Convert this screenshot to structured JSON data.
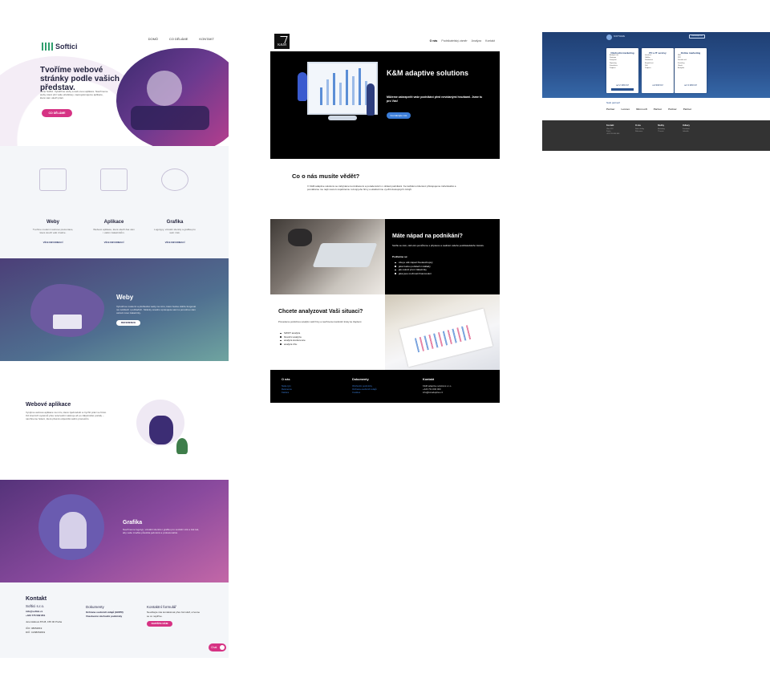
{
  "softici": {
    "logo_text": "Softici",
    "nav": [
      "DOMŮ",
      "CO DĚLÁME",
      "KONTAKT"
    ],
    "hero_title": "Tvoříme webové stránky podle vašich představ.",
    "hero_lead": "Jsme Softici. Vytváříme weby a web-ovou aplikace. Navrhneme weby, které plní vaše představy, naprogramujeme aplikace, které vám ušetří práci.",
    "hero_cta": "CO DĚLÁME",
    "services": [
      {
        "title": "Weby",
        "desc": "Tvoříme moderní webové prezentace, které slouží vaší značce.",
        "link": "VÍCE INFORMACÍ"
      },
      {
        "title": "Aplikace",
        "desc": "Webové aplikace, které ušetří čas vám i vašim zákazníkům.",
        "link": "VÍCE INFORMACÍ"
      },
      {
        "title": "Grafika",
        "desc": "Logotypy, vizuální identity a grafika pro web i tisk.",
        "link": "VÍCE INFORMACÍ"
      }
    ],
    "weby": {
      "title": "Weby",
      "desc": "Vytvoříme moderní a přehledné weby na míru, které budou dobře fungovat na mobilech i počítačích. Stránky snadno spravujete sami a pomohou vám oslovit nové zákazníky.",
      "button": "REFERENCE"
    },
    "apps": {
      "title": "Webové aplikace",
      "desc": "Vyvíjíme webové aplikace na míru, které zjednoduší a zrychlí práci ve firmě. Od interních systémů přes rezervační nástroje až po zákaznické portály – navrhneme řešení, které přesně odpovídá vašim procesům."
    },
    "graf": {
      "title": "Grafika",
      "desc": "Navrhneme logotyp, vizuální identitu i grafiku pro sociální sítě a tisk tak, aby vaše značka působila jednotně a profesionálně."
    },
    "footer": {
      "heading": "Kontakt",
      "company": "Softici s.r.o.",
      "email": "info@softici.cz",
      "phone": "+420 775 582 851",
      "address": "Jeremiášova 871/8, 155 00 Praha",
      "ico": "IČO: 08054819",
      "dic": "DIČ: CZ08054819",
      "docs_heading": "Dokumenty",
      "doc1": "Ochrana osobních údajů (GDPR)",
      "doc2": "Všeobecné obchodní podmínky",
      "form_heading": "Kontaktní formulář",
      "form_desc": "Neváhejte nás kontaktovat přes formulář, ozveme se co nejdříve.",
      "form_button": "NAPIŠTE NÁM",
      "chat_label": "Chat"
    }
  },
  "km": {
    "logo_text": "K&M",
    "nav": [
      "O nás",
      "Podnikatelský záměr",
      "Analýza",
      "Kontakt"
    ],
    "hero_title": "K&M adaptive solutions",
    "hero_sub": "Můžeme zabezpečit vaše podnikání před nevídanými hrozbami. Jsme tu pro Vás!",
    "hero_btn": "Kontaktujte nás",
    "about_title": "Co o nás musíte vědět?",
    "about_desc": "V K&M adaptive solutions se zabýváme konzultacemi a poradenstvím v oblasti podnikání. Ke každému klientovi přistupujeme individuálně a pomáháme mu najít cestu k úspěšnému rozvoji jeho firmy a efektivnímu využití dostupných zdrojů.",
    "idea_title": "Máte nápad na podnikání?",
    "idea_desc": "Svěřte se nám, rádi vám pomůžeme s přípravou a realizací vašeho podnikatelského záměru.",
    "idea_sub": "Podíváme se:",
    "idea_list": [
      "zda je váš nápad životaschopný",
      "jaké budou počáteční náklady",
      "jak oslovit první zákazníky",
      "jaké jsou možnosti financování"
    ],
    "analysis_title": "Chcete analyzovat Vaši situaci?",
    "analysis_desc": "Provedeme podrobnou analýzu vaší firmy a navrhneme konkrétní kroky ke zlepšení.",
    "analysis_list": [
      "SWOT analýza",
      "finanční analýza",
      "analýza konkurence",
      "analýza trhu"
    ],
    "footer": {
      "col1_h": "O nás",
      "col1": [
        "Naše tým",
        "Reference",
        "Kariéra"
      ],
      "col2_h": "Dokumenty",
      "col2": [
        "Obchodní podmínky",
        "Ochrana osobních údajů",
        "Cookies"
      ],
      "col3_h": "Kontakt",
      "col3": [
        "K&M adaptive solutions s.r.o.",
        "+420 731 000 000",
        "info@kmadaptive.cz"
      ]
    }
  },
  "pricing": {
    "logo_text": "SOFTWARE",
    "top_button": "Kontaktujte nás",
    "cards": [
      {
        "title": "Obchodní marketing",
        "rows": [
          "Analýza trhu",
          "Strategie",
          "Kampaně",
          "Reporting",
          "Konzultace",
          "Podpora"
        ],
        "price": "od 2 900 Kč"
      },
      {
        "title": "PC a IT servisy",
        "rows": [
          "Instalace",
          "Údržba",
          "Zálohování",
          "Bezpečnost",
          "Sítě",
          "Podpora"
        ],
        "price": "od 990 Kč"
      },
      {
        "title": "Online marketing",
        "rows": [
          "SEO",
          "PPC",
          "Sociální sítě",
          "E-mailing",
          "Obsah",
          "Analytika"
        ],
        "price": "od 4 900 Kč"
      }
    ],
    "partners_title": "Naši partneři",
    "partners": [
      "Partner",
      "Lenovo",
      "Microsoft",
      "Partner",
      "Partner",
      "Partner"
    ],
    "footer": [
      {
        "h": "Kontakt",
        "rows": [
          "Ulice 123",
          "Praha",
          "+420 700 000 000"
        ]
      },
      {
        "h": "O nás",
        "rows": [
          "Naše služby",
          "Reference"
        ]
      },
      {
        "h": "Služby",
        "rows": [
          "Marketing",
          "IT servis"
        ]
      },
      {
        "h": "Odkazy",
        "rows": [
          "Facebook",
          "LinkedIn"
        ]
      }
    ]
  }
}
